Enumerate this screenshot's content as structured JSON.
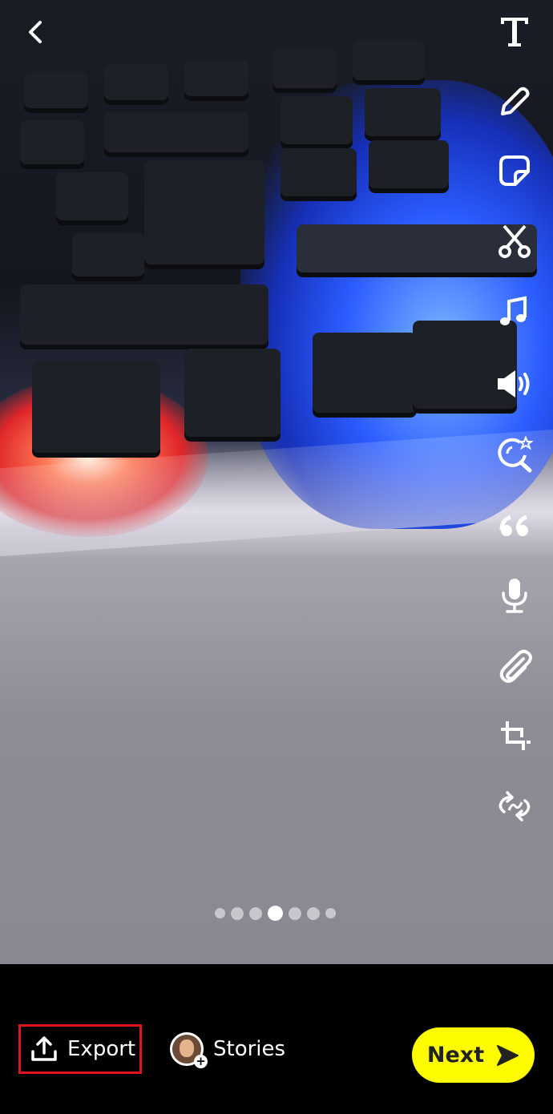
{
  "editor": {
    "back_icon": "chevron-left-icon",
    "toolbar": [
      {
        "name": "text",
        "icon": "text-icon"
      },
      {
        "name": "draw",
        "icon": "pencil-icon"
      },
      {
        "name": "sticker",
        "icon": "sticker-icon"
      },
      {
        "name": "scissors",
        "icon": "scissors-icon"
      },
      {
        "name": "music",
        "icon": "music-note-icon"
      },
      {
        "name": "sound",
        "icon": "speaker-icon"
      },
      {
        "name": "lens",
        "icon": "lens-search-star-icon"
      },
      {
        "name": "quote",
        "icon": "quote-icon"
      },
      {
        "name": "voice",
        "icon": "microphone-icon"
      },
      {
        "name": "attach",
        "icon": "paperclip-icon"
      },
      {
        "name": "crop",
        "icon": "crop-icon"
      },
      {
        "name": "loop",
        "icon": "loop-icon"
      }
    ],
    "pagination": {
      "total": 7,
      "active_index": 3
    }
  },
  "bottom_bar": {
    "export_label": "Export",
    "stories_label": "Stories",
    "next_label": "Next"
  },
  "colors": {
    "next_button": "#fffc00",
    "highlight_box": "#e0141c"
  }
}
